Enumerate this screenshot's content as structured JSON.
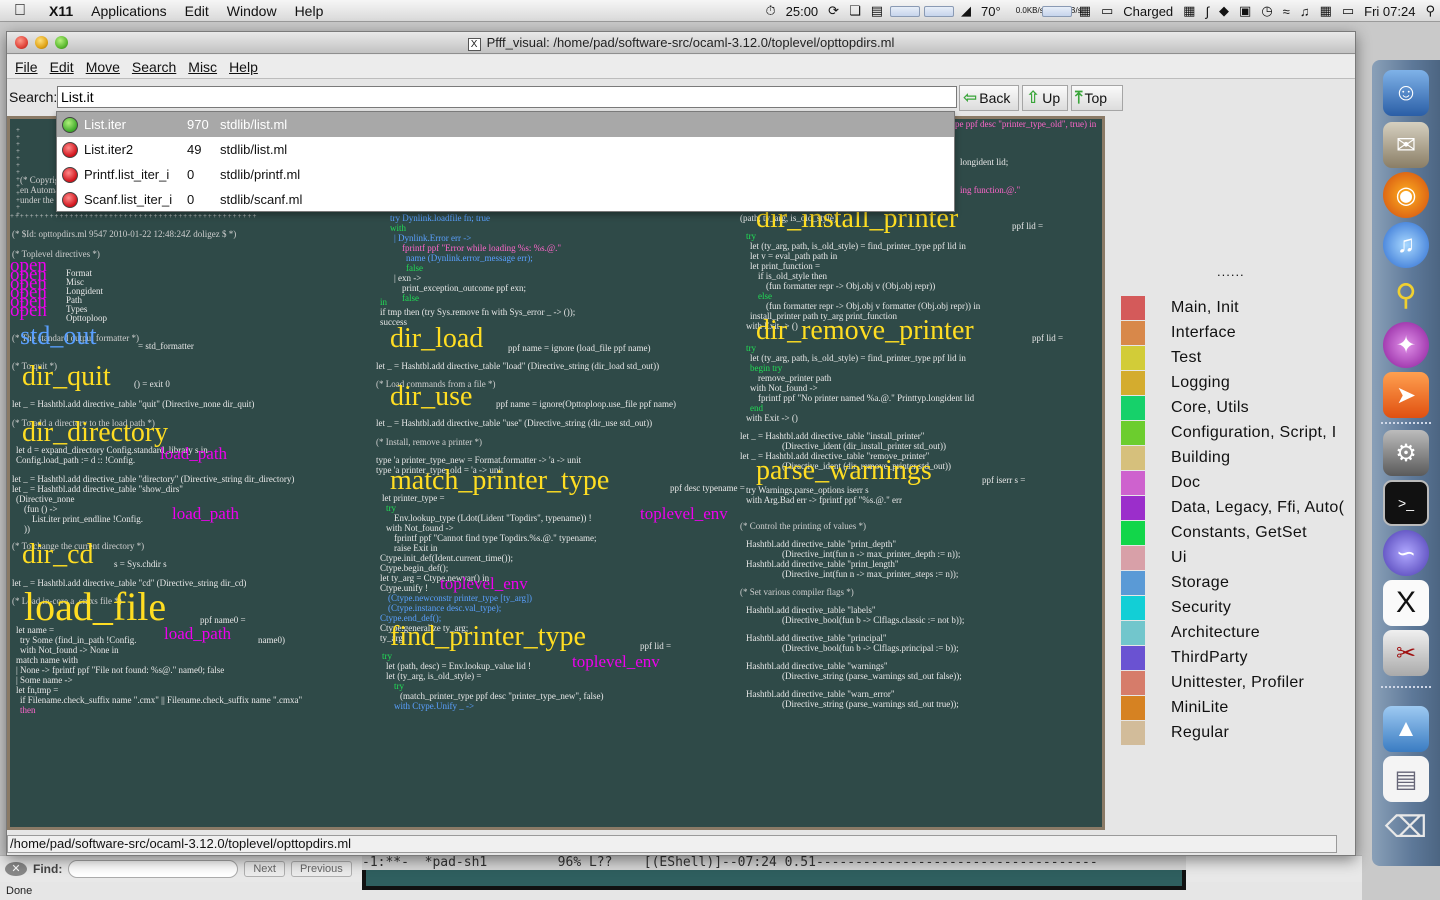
{
  "menubar": {
    "app": "X11",
    "items": [
      "Applications",
      "Edit",
      "Window",
      "Help"
    ],
    "timer": "25:00",
    "temperature": "70°",
    "net_up": "0.0KB/s",
    "net_down": "0.0KB/s",
    "battery": "Charged",
    "clock": "Fri 07:24"
  },
  "window": {
    "title": "Pfff_visual: /home/pad/software-src/ocaml-3.12.0/toplevel/opttopdirs.ml",
    "menus": [
      "File",
      "Edit",
      "Move",
      "Search",
      "Misc",
      "Help"
    ]
  },
  "search": {
    "label": "Search:",
    "value": "List.it",
    "back": "Back",
    "up": "Up",
    "top": "Top"
  },
  "completions": [
    {
      "name": "List.iter",
      "count": "970",
      "file": "stdlib/list.ml",
      "status": "green"
    },
    {
      "name": "List.iter2",
      "count": "49",
      "file": "stdlib/list.ml",
      "status": "red"
    },
    {
      "name": "Printf.list_iter_i",
      "count": "0",
      "file": "stdlib/printf.ml",
      "status": "red"
    },
    {
      "name": "Scanf.list_iter_i",
      "count": "0",
      "file": "stdlib/scanf.ml",
      "status": "red"
    }
  ],
  "code": {
    "col1": {
      "header": [
        "(* Copyright *)",
        "en Automatique.",
        "under the"
      ],
      "id_line": "(* $Id: opttopdirs.ml 9547 2010-01-22 12:48:24Z doligez $ *)",
      "toplevel_comment": "(* Toplevel directives *)",
      "opens": [
        "Format",
        "Misc",
        "Longident",
        "Path",
        "Types",
        "Opttoploop"
      ],
      "open_kw": "open",
      "std_out_comment": "(* The standard output formatter *)",
      "std_out": "std_out",
      "std_out_rest": "= std_formatter",
      "quit_comment": "(* To quit *)",
      "dir_quit": "dir_quit",
      "dir_quit_rest": "() = exit 0",
      "quit_reg": "let _ = Hashtbl.add directive_table \"quit\" (Directive_none dir_quit)",
      "dir_comment": "(* To add a directory to the load path *)",
      "dir_directory": "dir_directory",
      "dir_dir_l1": "let d = expand_directory Config.standard_library s in",
      "dir_dir_l2": "Config.load_path := d :: !Config.",
      "load_path": "load_path",
      "dir_reg1": "let _ = Hashtbl.add directive_table \"directory\" (Directive_string dir_directory)",
      "dir_reg2": "let _ = Hashtbl.add directive_table \"show_dirs\"",
      "dir_reg3": "(Directive_none",
      "dir_reg4": "(fun () ->",
      "dir_reg5": "List.iter print_endline !Config.",
      "dir_reg6": "))",
      "cd_comment": "(* To change the current directory *)",
      "dir_cd": "dir_cd",
      "dir_cd_rest": "s = Sys.chdir s",
      "cd_reg": "let _ = Hashtbl.add directive_table \"cd\" (Directive_string dir_cd)",
      "load_comment": "(* Load in-core a .cmxs file *)",
      "load_file": "load_file",
      "load_file_rest": "ppf name0 =",
      "lf1": "let name =",
      "lf2": "try Some (find_in_path !Config.",
      "lf2b": "name0)",
      "lf3": "with Not_found -> None in",
      "lf4": "match name with",
      "lf5": "| None -> fprintf ppf \"File not found: %s@.\" name0; false",
      "lf6": "| Some name ->",
      "lf7": "let fn,tmp =",
      "lf8": "if Filename.check_suffix name \".cmx\" || Filename.check_suffix name \".cmxa\"",
      "lf9": "then"
    },
    "col2": {
      "top1": "try Dynlink.loadfile fn; true",
      "top2": "with",
      "top3": "| Dynlink.Error err ->",
      "top4": "fprintf ppf \"Error while loading %s: %s.@.\"",
      "top5": "name (Dynlink.error_message err);",
      "top6": "false",
      "top7": "| exn ->",
      "top8": "print_exception_outcome ppf exn;",
      "top9": "false",
      "top10": "in",
      "top11": "if tmp then (try Sys.remove fn with Sys_error _ -> ());",
      "top12": "success",
      "dir_load": "dir_load",
      "dir_load_rest": "ppf name = ignore (load_file ppf name)",
      "load_reg": "let _ = Hashtbl.add directive_table \"load\" (Directive_string (dir_load std_out))",
      "use_comment": "(* Load commands from a file *)",
      "dir_use": "dir_use",
      "dir_use_rest": "ppf name = ignore(Opttoploop.use_file ppf name)",
      "use_reg": "let _ = Hashtbl.add directive_table \"use\" (Directive_string (dir_use std_out))",
      "install_comment": "(* Install, remove a printer *)",
      "t1": "type 'a printer_type_new = Format.formatter -> 'a -> unit",
      "t2": "type 'a printer_type_old = 'a -> unit",
      "match_printer_type": "match_printer_type",
      "mpt_rest": "ppf desc typename =",
      "m1": "let printer_type =",
      "m2": "try",
      "m3": "Env.lookup_type (Ldot(Lident \"Topdirs\", typename)) !",
      "toplevel_env": "toplevel_env",
      "m4": "with Not_found ->",
      "m5": "fprintf ppf \"Cannot find type Topdirs.%s.@.\" typename;",
      "m6": "raise Exit in",
      "m7": "Ctype.init_def(Ident.current_time());",
      "m8": "Ctype.begin_def();",
      "m9": "let ty_arg = Ctype.newvar() in",
      "m10": "Ctype.unify !",
      "m11": "(Ctype.newconstr printer_type [ty_arg])",
      "m12": "(Ctype.instance desc.val_type);",
      "m13": "Ctype.end_def();",
      "m14": "Ctype.generalize ty_arg;",
      "m15": "ty_arg",
      "find_printer_type": "find_printer_type",
      "fpt_rest": "ppf lid =",
      "f1": "try",
      "f2": "let (path, desc) = Env.lookup_value lid !",
      "f3": "let (ty_arg, is_old_style) =",
      "f4": "try",
      "f5": "(match_printer_type ppf desc \"printer_type_new\", false)",
      "f6": "with Ctype.Unify _ ->"
    },
    "col3": {
      "top1": "(match_printer_type ppf desc \"printer_type_old\", true) in",
      "top2": "(path, ty_arg, is_old_style)",
      "top3": "longident lid;",
      "top4": "ing function.@.\"",
      "dir_install_printer": "dir_install_printer",
      "dip_rest": "ppf lid =",
      "i1": "try",
      "i2": "let (ty_arg, path, is_old_style) = find_printer_type ppf lid in",
      "i3": "let v = eval_path path in",
      "i4": "let print_function =",
      "i5": "if is_old_style then",
      "i6": "(fun formatter repr -> Obj.obj v (Obj.obj repr))",
      "i7": "else",
      "i8": "(fun formatter repr -> Obj.obj v formatter (Obj.obj repr)) in",
      "i9": "install_printer path ty_arg print_function",
      "i10": "with Exit -> ()",
      "dir_remove_printer": "dir_remove_printer",
      "drp_rest": "ppf lid =",
      "r1": "try",
      "r2": "let (ty_arg, path, is_old_style) = find_printer_type ppf lid in",
      "r3": "begin try",
      "r4": "remove_printer path",
      "r5": "with Not_found ->",
      "r6": "fprintf ppf \"No printer named %a.@.\" Printtyp.longident lid",
      "r7": "end",
      "r8": "with Exit -> ()",
      "reg1": "let _ = Hashtbl.add directive_table \"install_printer\"",
      "reg2": "(Directive_ident (dir_install_printer std_out))",
      "reg3": "let _ = Hashtbl.add directive_table \"remove_printer\"",
      "reg4": "(Directive_ident (dir_remove_printer std_out))",
      "parse_warnings": "parse_warnings",
      "pw_rest": "ppf iserr s =",
      "p1": "try Warnings.parse_options iserr s",
      "p2": "with Arg.Bad err -> fprintf ppf \"%s.@.\" err",
      "ctrl_comment": "(* Control the printing of values *)",
      "c1": "Hashtbl.add directive_table \"print_depth\"",
      "c2": "(Directive_int(fun n -> max_printer_depth := n));",
      "c3": "Hashtbl.add directive_table \"print_length\"",
      "c4": "(Directive_int(fun n -> max_printer_steps := n));",
      "flags_comment": "(* Set various compiler flags *)",
      "g1": "Hashtbl.add directive_table \"labels\"",
      "g2": "(Directive_bool(fun b -> Clflags.classic := not b));",
      "g3": "Hashtbl.add directive_table \"principal\"",
      "g4": "(Directive_bool(fun b -> Clflags.principal := b));",
      "g5": "Hashtbl.add directive_table \"warnings\"",
      "g6": "(Directive_string (parse_warnings std_out false));",
      "g7": "Hashtbl.add directive_table \"warn_error\"",
      "g8": "(Directive_string (parse_warnings std_out true));"
    }
  },
  "legend": {
    "dots": "......",
    "items": [
      {
        "label": "Main, Init",
        "color": "#d45a5a"
      },
      {
        "label": "Interface",
        "color": "#d8884a"
      },
      {
        "label": "Test",
        "color": "#d2cc38"
      },
      {
        "label": "Logging",
        "color": "#d4ac2e"
      },
      {
        "label": "Core, Utils",
        "color": "#16d16a"
      },
      {
        "label": "Configuration, Script, I",
        "color": "#6ccd2e"
      },
      {
        "label": "Building",
        "color": "#d6c07c"
      },
      {
        "label": "Doc",
        "color": "#ce62ce"
      },
      {
        "label": "Data, Legacy, Ffi, Auto(",
        "color": "#9b2ecb"
      },
      {
        "label": "Constants, GetSet",
        "color": "#12d64a"
      },
      {
        "label": "Ui",
        "color": "#d8a0a8"
      },
      {
        "label": "Storage",
        "color": "#5a9ad6"
      },
      {
        "label": "Security",
        "color": "#12cfd6"
      },
      {
        "label": "Architecture",
        "color": "#72c6cc"
      },
      {
        "label": "ThirdParty",
        "color": "#6a52d2"
      },
      {
        "label": "Unittester, Profiler",
        "color": "#d67c6a"
      },
      {
        "label": "MiniLite",
        "color": "#d68222"
      },
      {
        "label": "Regular",
        "color": "#d2bc9a"
      }
    ]
  },
  "statusbar": "/home/pad/software-src/ocaml-3.12.0/toplevel/opttopdirs.ml",
  "behind": {
    "find_label": "Find:",
    "next": "Next",
    "previous": "Previous",
    "done": "Done",
    "emacs_modeline": "-1:**-  *pad-sh1         96% L??    [(EShell)]--07:24 0.51------------------------------------"
  }
}
